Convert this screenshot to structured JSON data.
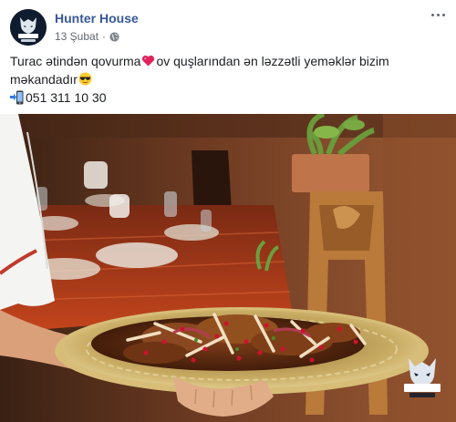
{
  "post": {
    "author": "Hunter House",
    "date": "13 Şubat",
    "separator": "·",
    "privacy_icon": "globe-icon",
    "more_icon": "more-options-icon",
    "text": {
      "part1": "Turac ətindən qovurma",
      "emoji_heart": "heart-icon",
      "part2": "ov quşlarından ən ləzzətli yeməklər bizim",
      "part3": "məkandadır",
      "emoji_sunglasses": "sunglasses-icon",
      "emoji_phone": "mobile-phone-arrow-icon",
      "phone": "051 311 10 30"
    }
  },
  "logo": {
    "line1": "HUNTER",
    "line2": "HOUSE"
  },
  "colors": {
    "author_link": "#385898",
    "meta_text": "#616770",
    "heart": "#e0245e",
    "logo_bg": "#0f1b2e",
    "tablecloth": "#b23a1a",
    "tray": "#b89a55"
  }
}
